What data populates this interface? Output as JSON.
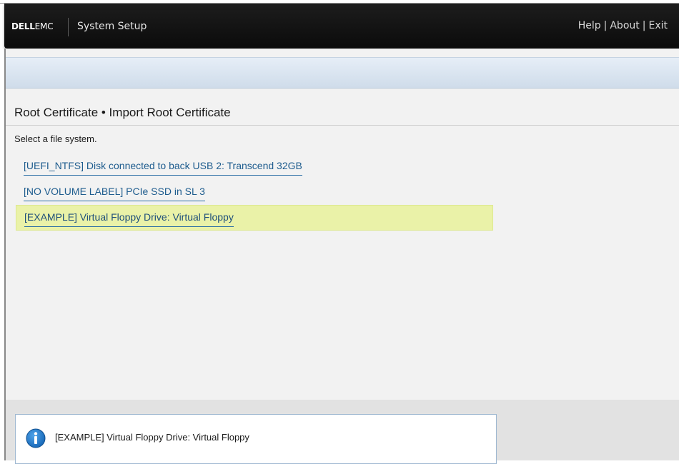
{
  "header": {
    "logo_dell": "DELL",
    "logo_emc": "EMC",
    "app_title": "System Setup",
    "links": [
      "Help",
      "About",
      "Exit"
    ],
    "separator": "|"
  },
  "main": {
    "page_title": "Root Certificate • Import Root Certificate",
    "instructions": "Select a file system.",
    "file_systems": [
      {
        "label": "[UEFI_NTFS] Disk connected to back USB 2: Transcend 32GB",
        "selected": false
      },
      {
        "label": "[NO VOLUME LABEL] PCIe SSD in SL 3",
        "selected": false
      },
      {
        "label": "[EXAMPLE] Virtual Floppy Drive: Virtual Floppy",
        "selected": true
      }
    ]
  },
  "help_panel": {
    "icon": "info-icon",
    "text": "[EXAMPLE] Virtual Floppy Drive: Virtual Floppy"
  },
  "colors": {
    "header_bg": "#111111",
    "link_blue": "#1e5c8e",
    "selected_bg": "#eaf2a8",
    "info_blue": "#1976c8"
  }
}
